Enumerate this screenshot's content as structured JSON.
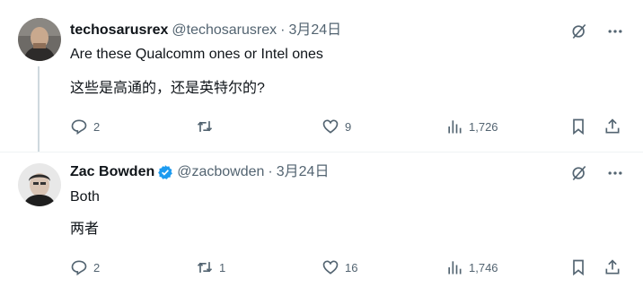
{
  "tweets": [
    {
      "author_name": "techosarusrex",
      "handle": "@techosarusrex",
      "separator": "·",
      "date": "3月24日",
      "text_lines": [
        "Are these Qualcomm ones or Intel ones",
        "这些是高通的，还是英特尔的?"
      ],
      "replies": "2",
      "retweets": "",
      "likes": "9",
      "views": "1,726",
      "verified": false
    },
    {
      "author_name": "Zac Bowden",
      "handle": "@zacbowden",
      "separator": "·",
      "date": "3月24日",
      "text_lines": [
        "Both",
        "两者"
      ],
      "replies": "2",
      "retweets": "1",
      "likes": "16",
      "views": "1,746",
      "verified": true
    }
  ],
  "colors": {
    "text": "#0f1419",
    "secondary": "#536471",
    "verified": "#1d9bf0",
    "thread_line": "#cfd9de"
  },
  "icons": [
    "reply-icon",
    "retweet-icon",
    "like-icon",
    "views-icon",
    "bookmark-icon",
    "share-icon",
    "grok-icon",
    "more-icon",
    "verified-icon"
  ]
}
